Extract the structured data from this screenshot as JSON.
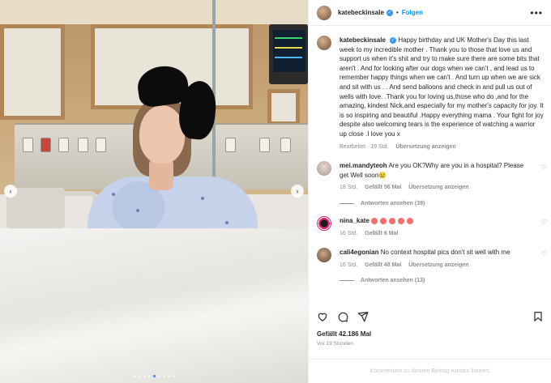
{
  "header": {
    "username": "katebeckinsale",
    "separator": "•",
    "follow_label": "Folgen",
    "more_label": "•••"
  },
  "media": {
    "prev_label": "‹",
    "next_label": "›",
    "dots_count": 9,
    "active_dot": 4
  },
  "caption": {
    "username": "katebeckinsale",
    "text": "Happy birthday and UK Mother's Day this last week to my incredible mother . Thank you to those that love us and support us when it's shit and try to make sure there are some bits that aren't . And for looking after our dogs when we can't , and lead us to remember happy things when we can't . And turn up when we are sick and sit with us . . And send balloons and check in and pull us out of wells with love. .Thank you for loving us,those who do ,and for the amazing, kindest Nick,and especially for my mother's capacity for joy. It is so inspiring and beautiful .Happy everything mama . Your fight for joy despite also welcoming tears is the experience of watching a warrior up close .I love you x",
    "edited_label": "Bearbeitet",
    "time": "19 Std.",
    "translate_label": "Übersetzung anzeigen"
  },
  "comments": [
    {
      "username": "mei.mandyteoh",
      "text": "Are you OK?Why are you in a hospital? Please get Well soon😢",
      "time": "18 Std.",
      "likes": "Gefällt 56 Mal",
      "translate_label": "Übersetzung anzeigen",
      "replies_label": "Antworten ansehen (39)"
    },
    {
      "username": "nina_kate",
      "time": "16 Std.",
      "likes": "Gefällt 6 Mal",
      "emoji_count": 5
    },
    {
      "username": "cali4egonian",
      "text": "No context hospital pics don't sit well with me",
      "time": "16 Std.",
      "likes": "Gefällt 48 Mal",
      "translate_label": "Übersetzung anzeigen",
      "replies_label": "Antworten ansehen (13)"
    }
  ],
  "footer_section": {
    "likes": "Gefällt 42.186 Mal",
    "time": "Vor 19 Stunden",
    "comments_limited": "Kommentare zu diesem Beitrag wurden limitiert."
  },
  "colors": {
    "accent": "#0095f6",
    "verified": "#3897f0",
    "muted": "#8e8e8e",
    "text": "#262626"
  },
  "icons": [
    "heart-icon",
    "comment-icon",
    "share-icon",
    "save-icon",
    "verified-icon",
    "more-icon"
  ]
}
